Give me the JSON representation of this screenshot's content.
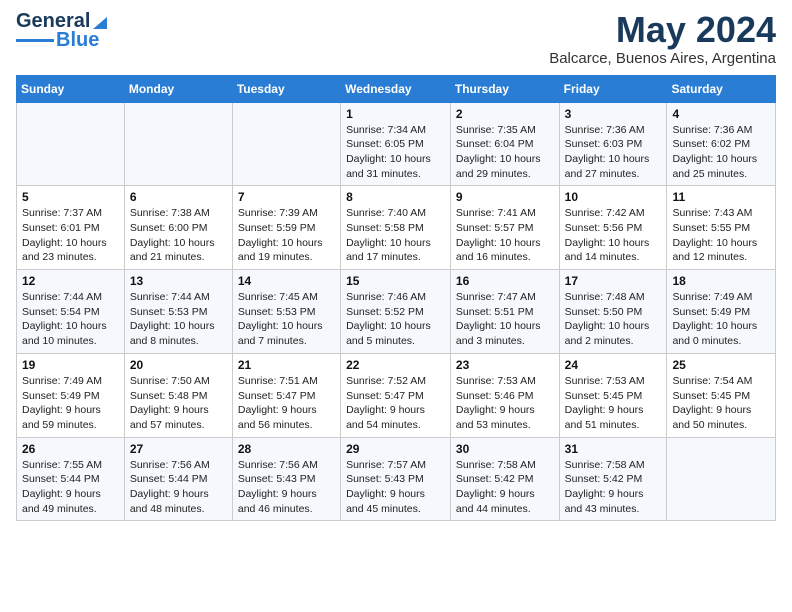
{
  "logo": {
    "line1": "General",
    "line2": "Blue"
  },
  "header": {
    "month": "May 2024",
    "location": "Balcarce, Buenos Aires, Argentina"
  },
  "weekdays": [
    "Sunday",
    "Monday",
    "Tuesday",
    "Wednesday",
    "Thursday",
    "Friday",
    "Saturday"
  ],
  "weeks": [
    [
      {
        "day": "",
        "info": ""
      },
      {
        "day": "",
        "info": ""
      },
      {
        "day": "",
        "info": ""
      },
      {
        "day": "1",
        "info": "Sunrise: 7:34 AM\nSunset: 6:05 PM\nDaylight: 10 hours\nand 31 minutes."
      },
      {
        "day": "2",
        "info": "Sunrise: 7:35 AM\nSunset: 6:04 PM\nDaylight: 10 hours\nand 29 minutes."
      },
      {
        "day": "3",
        "info": "Sunrise: 7:36 AM\nSunset: 6:03 PM\nDaylight: 10 hours\nand 27 minutes."
      },
      {
        "day": "4",
        "info": "Sunrise: 7:36 AM\nSunset: 6:02 PM\nDaylight: 10 hours\nand 25 minutes."
      }
    ],
    [
      {
        "day": "5",
        "info": "Sunrise: 7:37 AM\nSunset: 6:01 PM\nDaylight: 10 hours\nand 23 minutes."
      },
      {
        "day": "6",
        "info": "Sunrise: 7:38 AM\nSunset: 6:00 PM\nDaylight: 10 hours\nand 21 minutes."
      },
      {
        "day": "7",
        "info": "Sunrise: 7:39 AM\nSunset: 5:59 PM\nDaylight: 10 hours\nand 19 minutes."
      },
      {
        "day": "8",
        "info": "Sunrise: 7:40 AM\nSunset: 5:58 PM\nDaylight: 10 hours\nand 17 minutes."
      },
      {
        "day": "9",
        "info": "Sunrise: 7:41 AM\nSunset: 5:57 PM\nDaylight: 10 hours\nand 16 minutes."
      },
      {
        "day": "10",
        "info": "Sunrise: 7:42 AM\nSunset: 5:56 PM\nDaylight: 10 hours\nand 14 minutes."
      },
      {
        "day": "11",
        "info": "Sunrise: 7:43 AM\nSunset: 5:55 PM\nDaylight: 10 hours\nand 12 minutes."
      }
    ],
    [
      {
        "day": "12",
        "info": "Sunrise: 7:44 AM\nSunset: 5:54 PM\nDaylight: 10 hours\nand 10 minutes."
      },
      {
        "day": "13",
        "info": "Sunrise: 7:44 AM\nSunset: 5:53 PM\nDaylight: 10 hours\nand 8 minutes."
      },
      {
        "day": "14",
        "info": "Sunrise: 7:45 AM\nSunset: 5:53 PM\nDaylight: 10 hours\nand 7 minutes."
      },
      {
        "day": "15",
        "info": "Sunrise: 7:46 AM\nSunset: 5:52 PM\nDaylight: 10 hours\nand 5 minutes."
      },
      {
        "day": "16",
        "info": "Sunrise: 7:47 AM\nSunset: 5:51 PM\nDaylight: 10 hours\nand 3 minutes."
      },
      {
        "day": "17",
        "info": "Sunrise: 7:48 AM\nSunset: 5:50 PM\nDaylight: 10 hours\nand 2 minutes."
      },
      {
        "day": "18",
        "info": "Sunrise: 7:49 AM\nSunset: 5:49 PM\nDaylight: 10 hours\nand 0 minutes."
      }
    ],
    [
      {
        "day": "19",
        "info": "Sunrise: 7:49 AM\nSunset: 5:49 PM\nDaylight: 9 hours\nand 59 minutes."
      },
      {
        "day": "20",
        "info": "Sunrise: 7:50 AM\nSunset: 5:48 PM\nDaylight: 9 hours\nand 57 minutes."
      },
      {
        "day": "21",
        "info": "Sunrise: 7:51 AM\nSunset: 5:47 PM\nDaylight: 9 hours\nand 56 minutes."
      },
      {
        "day": "22",
        "info": "Sunrise: 7:52 AM\nSunset: 5:47 PM\nDaylight: 9 hours\nand 54 minutes."
      },
      {
        "day": "23",
        "info": "Sunrise: 7:53 AM\nSunset: 5:46 PM\nDaylight: 9 hours\nand 53 minutes."
      },
      {
        "day": "24",
        "info": "Sunrise: 7:53 AM\nSunset: 5:45 PM\nDaylight: 9 hours\nand 51 minutes."
      },
      {
        "day": "25",
        "info": "Sunrise: 7:54 AM\nSunset: 5:45 PM\nDaylight: 9 hours\nand 50 minutes."
      }
    ],
    [
      {
        "day": "26",
        "info": "Sunrise: 7:55 AM\nSunset: 5:44 PM\nDaylight: 9 hours\nand 49 minutes."
      },
      {
        "day": "27",
        "info": "Sunrise: 7:56 AM\nSunset: 5:44 PM\nDaylight: 9 hours\nand 48 minutes."
      },
      {
        "day": "28",
        "info": "Sunrise: 7:56 AM\nSunset: 5:43 PM\nDaylight: 9 hours\nand 46 minutes."
      },
      {
        "day": "29",
        "info": "Sunrise: 7:57 AM\nSunset: 5:43 PM\nDaylight: 9 hours\nand 45 minutes."
      },
      {
        "day": "30",
        "info": "Sunrise: 7:58 AM\nSunset: 5:42 PM\nDaylight: 9 hours\nand 44 minutes."
      },
      {
        "day": "31",
        "info": "Sunrise: 7:58 AM\nSunset: 5:42 PM\nDaylight: 9 hours\nand 43 minutes."
      },
      {
        "day": "",
        "info": ""
      }
    ]
  ]
}
